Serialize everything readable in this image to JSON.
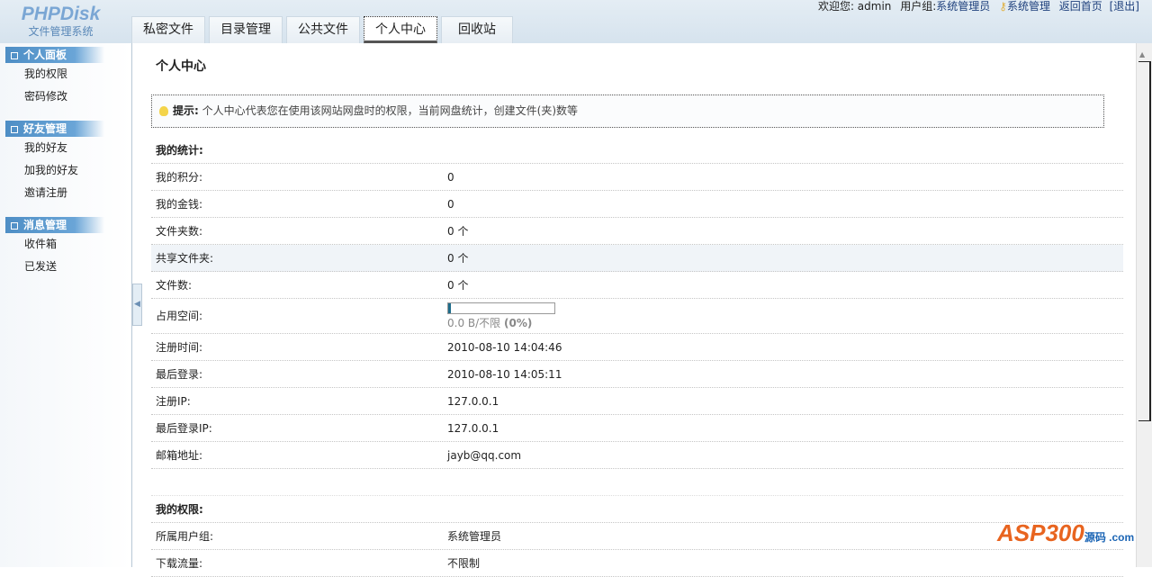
{
  "logo": {
    "name": "PHPDisk",
    "subtitle": "文件管理系统"
  },
  "tabs": [
    "私密文件",
    "目录管理",
    "公共文件",
    "个人中心",
    "回收站"
  ],
  "active_tab": "个人中心",
  "userbar": {
    "welcome": "欢迎您: admin",
    "group_label": "用户组:",
    "group": "系统管理员",
    "admin": "系统管理",
    "home": "返回首页",
    "logout": "[退出]"
  },
  "sidebar": [
    {
      "title": "个人面板",
      "items": [
        "我的权限",
        "密码修改"
      ]
    },
    {
      "title": "好友管理",
      "items": [
        "我的好友",
        "加我的好友",
        "邀请注册"
      ]
    },
    {
      "title": "消息管理",
      "items": [
        "收件箱",
        "已发送"
      ]
    }
  ],
  "main": {
    "title": "个人中心",
    "tip_label": "提示:",
    "tip_text": "个人中心代表您在使用该网站网盘时的权限，当前网盘统计，创建文件(夹)数等",
    "stats_header": "我的统计:",
    "stats": [
      {
        "k": "我的积分:",
        "v": "0"
      },
      {
        "k": "我的金钱:",
        "v": "0"
      },
      {
        "k": "文件夹数:",
        "v": "0 个"
      },
      {
        "k": "共享文件夹:",
        "v": "0 个"
      },
      {
        "k": "文件数:",
        "v": "0 个"
      }
    ],
    "space": {
      "k": "占用空间:",
      "usage": "0.0 B/不限",
      "percent_label": "(0%)",
      "percent": 0
    },
    "stats2": [
      {
        "k": "注册时间:",
        "v": "2010-08-10 14:04:46"
      },
      {
        "k": "最后登录:",
        "v": "2010-08-10 14:05:11"
      },
      {
        "k": "注册IP:",
        "v": "127.0.0.1"
      },
      {
        "k": "最后登录IP:",
        "v": "127.0.0.1"
      },
      {
        "k": "邮箱地址:",
        "v": "jayb@qq.com"
      }
    ],
    "perm_header": "我的权限:",
    "perms": [
      {
        "k": "所属用户组:",
        "v": "系统管理员"
      },
      {
        "k": "下载流量:",
        "v": "不限制"
      }
    ]
  },
  "watermark": {
    "text": "ASP300",
    "sub": "源码 .com"
  }
}
